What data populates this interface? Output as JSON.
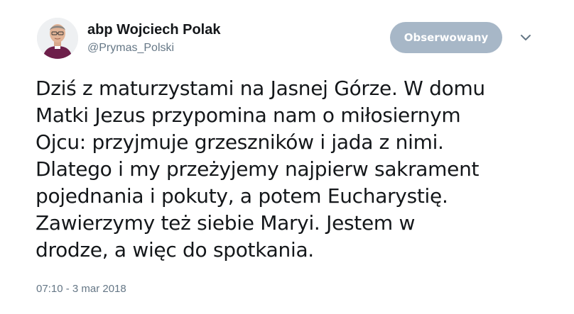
{
  "author": {
    "name": "abp Wojciech Polak",
    "handle": "@Prymas_Polski",
    "avatar_icon": "person-avatar-icon"
  },
  "follow_button": {
    "label": "Obserwowany",
    "color": "#a7b7c7"
  },
  "menu_icon": "chevron-down-icon",
  "tweet": {
    "lines": [
      "Dziś z maturzystami na Jasnej Górze. W domu",
      "Matki Jezus przypomina nam o miłosiernym",
      "Ojcu: przyjmuje grzeszników i jada z nimi.",
      "Dlatego i my przeżyjemy najpierw sakrament",
      "pojednania i pokuty, a potem Eucharystię.",
      "Zawierzymy też siebie Maryi. Jestem w",
      "drodze, a więc do spotkania."
    ],
    "timestamp": "07:10 - 3 mar 2018"
  },
  "colors": {
    "text": "#14171a",
    "secondary": "#657786"
  }
}
